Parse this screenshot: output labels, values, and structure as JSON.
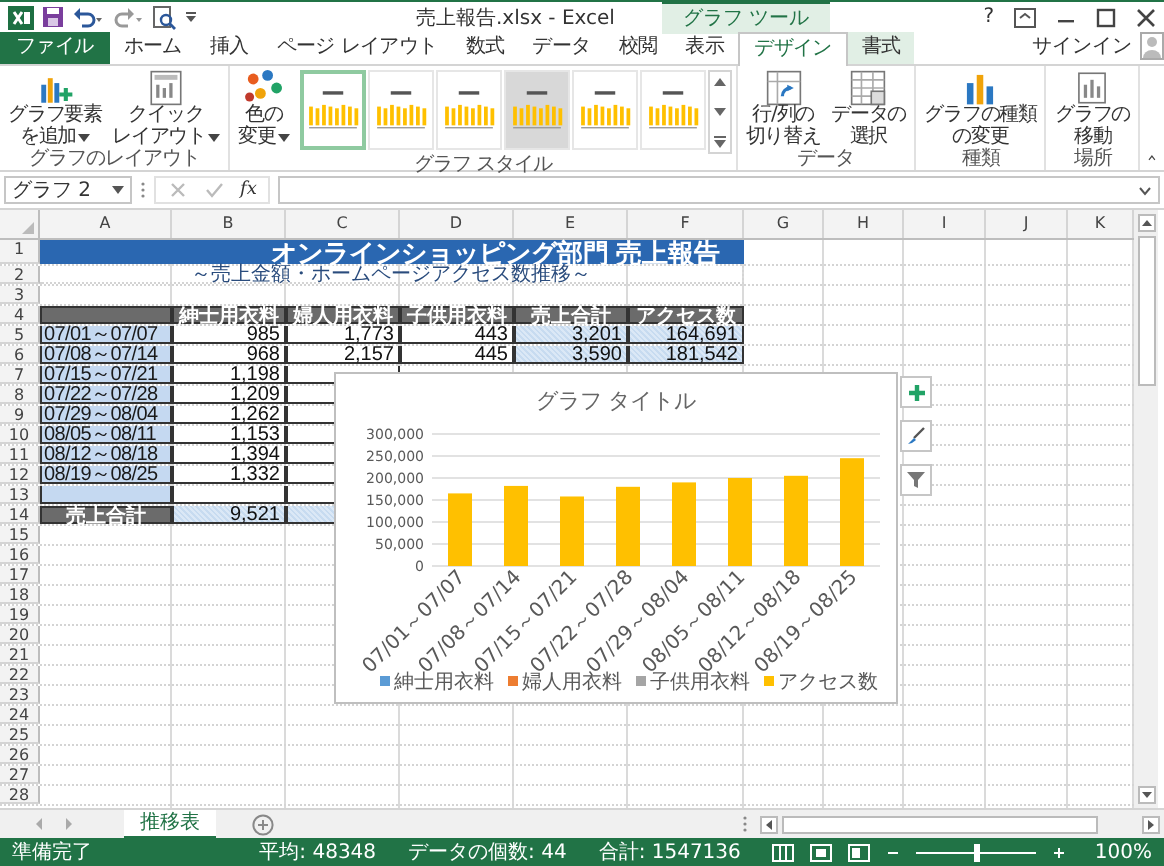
{
  "title_bar": {
    "title": "売上報告.xlsx - Excel",
    "context_label": "グラフ ツール",
    "help": "?"
  },
  "tabs": [
    {
      "label": "ファイル",
      "kind": "file",
      "selected": false
    },
    {
      "label": "ホーム",
      "kind": "normal",
      "selected": false
    },
    {
      "label": "挿入",
      "kind": "normal",
      "selected": false
    },
    {
      "label": "ページ レイアウト",
      "kind": "normal",
      "selected": false
    },
    {
      "label": "数式",
      "kind": "normal",
      "selected": false
    },
    {
      "label": "データ",
      "kind": "normal",
      "selected": false
    },
    {
      "label": "校閲",
      "kind": "normal",
      "selected": false
    },
    {
      "label": "表示",
      "kind": "normal",
      "selected": false
    },
    {
      "label": "デザイン",
      "kind": "context",
      "selected": true
    },
    {
      "label": "書式",
      "kind": "context",
      "selected": false
    }
  ],
  "sign_in": "サインイン",
  "ribbon": {
    "groups": [
      {
        "label": "グラフのレイアウト",
        "buttons": [
          {
            "kind": "add-element",
            "lines": [
              "グラフ要素",
              "を追加"
            ],
            "dropdown": true
          },
          {
            "kind": "quick-layout",
            "lines": [
              "クイック",
              "レイアウト"
            ],
            "dropdown": true
          }
        ]
      },
      {
        "label": "グラフ スタイル",
        "buttons": [
          {
            "kind": "colors",
            "lines": [
              "色の",
              "変更"
            ],
            "dropdown": true
          }
        ],
        "styles": [
          {
            "kind": "plain",
            "selected": true
          },
          {
            "kind": "plain",
            "selected": false
          },
          {
            "kind": "plain",
            "selected": false
          },
          {
            "kind": "shaded",
            "selected": false
          },
          {
            "kind": "plain",
            "selected": false
          },
          {
            "kind": "plain",
            "selected": false
          }
        ]
      },
      {
        "label": "データ",
        "buttons": [
          {
            "kind": "switch",
            "lines": [
              "行/列の",
              "切り替え"
            ],
            "dropdown": false
          },
          {
            "kind": "select-data",
            "lines": [
              "データの",
              "選択"
            ],
            "dropdown": false
          }
        ]
      },
      {
        "label": "種類",
        "buttons": [
          {
            "kind": "chart-type",
            "lines": [
              "グラフの種類",
              "の変更"
            ],
            "dropdown": false
          }
        ]
      },
      {
        "label": "場所",
        "buttons": [
          {
            "kind": "move",
            "lines": [
              "グラフの",
              "移動"
            ],
            "dropdown": false
          }
        ]
      }
    ]
  },
  "formula_bar": {
    "name_box": "グラフ 2",
    "function_label": "fx"
  },
  "sheet": {
    "columns": [
      "A",
      "B",
      "C",
      "D",
      "E",
      "F",
      "G",
      "H",
      "I",
      "J",
      "K"
    ],
    "rows": [
      {
        "number": "1",
        "cells": [
          {
            "kind": "title",
            "text": "オンラインショッピング部門 売上報告"
          }
        ]
      },
      {
        "number": "2",
        "cells": [
          {
            "kind": "subtitle",
            "text": "～売上金額・ホームページアクセス数推移～"
          }
        ]
      },
      {
        "number": "3",
        "cells": []
      },
      {
        "number": "4",
        "cells": [
          {
            "kind": "head"
          },
          {
            "kind": "head",
            "text": "紳士用衣料"
          },
          {
            "kind": "head",
            "text": "婦人用衣料"
          },
          {
            "kind": "head",
            "text": "子供用衣料"
          },
          {
            "kind": "head",
            "text": "売上合計"
          },
          {
            "kind": "head",
            "text": "アクセス数"
          }
        ]
      },
      {
        "number": "5",
        "cells": [
          {
            "kind": "label",
            "text": "07/01～07/07"
          },
          {
            "kind": "num",
            "text": "985"
          },
          {
            "kind": "num",
            "text": "1,773"
          },
          {
            "kind": "num",
            "text": "443"
          },
          {
            "kind": "total",
            "text": "3,201"
          },
          {
            "kind": "total",
            "text": "164,691"
          }
        ]
      },
      {
        "number": "6",
        "cells": [
          {
            "kind": "label",
            "text": "07/08～07/14"
          },
          {
            "kind": "num",
            "text": "968"
          },
          {
            "kind": "num",
            "text": "2,157"
          },
          {
            "kind": "num",
            "text": "445"
          },
          {
            "kind": "total",
            "text": "3,590"
          },
          {
            "kind": "total",
            "text": "181,542"
          }
        ]
      },
      {
        "number": "7",
        "cells": [
          {
            "kind": "label",
            "text": "07/15～07/21"
          },
          {
            "kind": "num",
            "text": "1,198"
          },
          {
            "kind": "num"
          }
        ]
      },
      {
        "number": "8",
        "cells": [
          {
            "kind": "label",
            "text": "07/22～07/28"
          },
          {
            "kind": "num",
            "text": "1,209"
          },
          {
            "kind": "num"
          }
        ]
      },
      {
        "number": "9",
        "cells": [
          {
            "kind": "label",
            "text": "07/29～08/04"
          },
          {
            "kind": "num",
            "text": "1,262"
          },
          {
            "kind": "num"
          }
        ]
      },
      {
        "number": "10",
        "cells": [
          {
            "kind": "label",
            "text": "08/05～08/11"
          },
          {
            "kind": "num",
            "text": "1,153"
          },
          {
            "kind": "num"
          }
        ]
      },
      {
        "number": "11",
        "cells": [
          {
            "kind": "label",
            "text": "08/12～08/18"
          },
          {
            "kind": "num",
            "text": "1,394"
          },
          {
            "kind": "num"
          }
        ]
      },
      {
        "number": "12",
        "cells": [
          {
            "kind": "label",
            "text": "08/19～08/25"
          },
          {
            "kind": "num",
            "text": "1,332"
          },
          {
            "kind": "num"
          }
        ]
      },
      {
        "number": "13",
        "cells": [
          {
            "kind": "label"
          },
          {
            "kind": "num"
          },
          {
            "kind": "num"
          }
        ]
      },
      {
        "number": "14",
        "cells": [
          {
            "kind": "head",
            "text": "売上合計"
          },
          {
            "kind": "total",
            "text": "9,521"
          },
          {
            "kind": "total"
          }
        ]
      },
      {
        "number": "15",
        "cells": []
      },
      {
        "number": "16",
        "cells": []
      },
      {
        "number": "17",
        "cells": []
      },
      {
        "number": "18",
        "cells": []
      },
      {
        "number": "19",
        "cells": []
      },
      {
        "number": "20",
        "cells": []
      },
      {
        "number": "21",
        "cells": []
      },
      {
        "number": "22",
        "cells": []
      },
      {
        "number": "23",
        "cells": []
      },
      {
        "number": "24",
        "cells": []
      },
      {
        "number": "25",
        "cells": []
      },
      {
        "number": "26",
        "cells": []
      },
      {
        "number": "27",
        "cells": []
      },
      {
        "number": "28",
        "cells": []
      }
    ]
  },
  "chart": {
    "chart_data": {
      "type": "bar",
      "title": "グラフ タイトル",
      "stacked": true,
      "grid": true,
      "legend": "bottom",
      "categories": [
        "07/01～07/07",
        "07/08～07/14",
        "07/15～07/21",
        "07/22～07/28",
        "07/29～08/04",
        "08/05～08/11",
        "08/12～08/18",
        "08/19～08/25"
      ],
      "series": [
        {
          "name": "紳士用衣料",
          "color": "#5b9bd5",
          "values": [
            0,
            0,
            0,
            0,
            0,
            0,
            0,
            0
          ]
        },
        {
          "name": "婦人用衣料",
          "color": "#ed7d31",
          "values": [
            0,
            0,
            null,
            null,
            null,
            null,
            null,
            null
          ]
        },
        {
          "name": "子供用衣料",
          "color": "#a5a5a5",
          "values": [
            0,
            0,
            null,
            null,
            null,
            null,
            null,
            null
          ]
        },
        {
          "name": "アクセス数",
          "color": "#ffc000",
          "values": [
            165000,
            182000,
            158000,
            180000,
            190000,
            200000,
            205000,
            245000
          ]
        }
      ],
      "ylim": [
        0,
        300000
      ],
      "yticks": [
        {
          "value": 0,
          "label": "0"
        },
        {
          "value": 50000,
          "label": "50,000"
        },
        {
          "value": 100000,
          "label": "100,000"
        },
        {
          "value": 150000,
          "label": "150,000"
        },
        {
          "value": 200000,
          "label": "200,000"
        },
        {
          "value": 250000,
          "label": "250,000"
        },
        {
          "value": 300000,
          "label": "300,000"
        }
      ]
    }
  },
  "sheet_tabs": [
    {
      "label": "推移表",
      "selected": true
    }
  ],
  "status_bar": {
    "ready": "準備完了",
    "average": "平均: 48348",
    "count": "データの個数: 44",
    "sum": "合計: 1547136",
    "zoom": "100%",
    "zoom_slider": {
      "level": 0.5
    }
  }
}
